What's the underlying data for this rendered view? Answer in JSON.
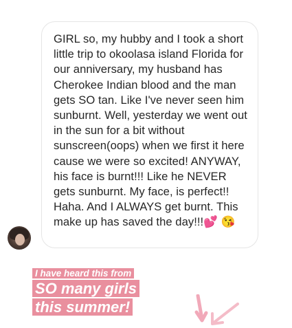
{
  "message": {
    "text": "GIRL so, my hubby and I took a short little trip to okoolasa island Florida for our anniversary, my husband has Cherokee Indian blood and the man gets SO tan. Like I've never seen him sunburnt. Well, yesterday we went out in the sun for a bit without sunscreen(oops) when we first it here cause we were so excited! ANYWAY, his face is burnt!!! Like he NEVER gets sunburnt. My face, is perfect!! Haha. And I ALWAYS get burnt. This make up has saved the day!!!💕 😘"
  },
  "caption": {
    "line1": "I have heard this from",
    "line2": "SO many girls",
    "line3": "this summer!",
    "highlight_color": "#e98f9e"
  },
  "icons": {
    "avatar": "avatar",
    "arrows": "pink-arrows-icon"
  }
}
